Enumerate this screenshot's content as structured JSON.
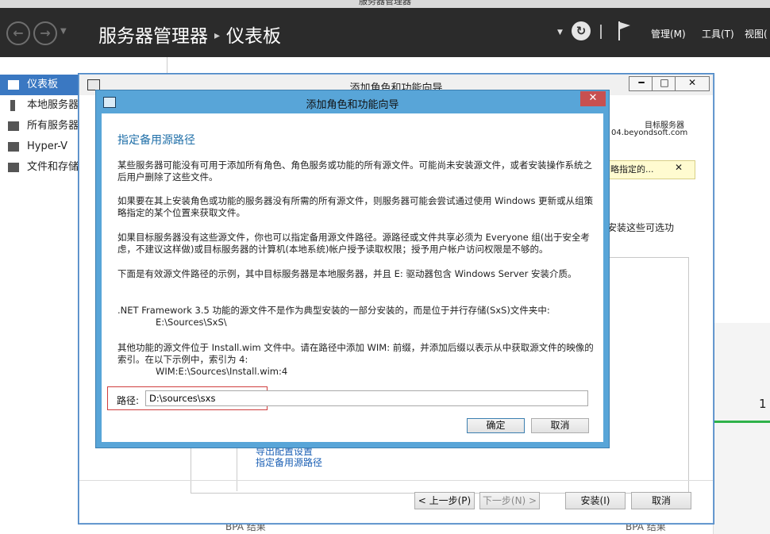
{
  "window": {
    "title": "服务器管理器"
  },
  "header": {
    "app": "服务器管理器",
    "page": "仪表板",
    "menus": [
      "管理(M)",
      "工具(T)",
      "视图("
    ]
  },
  "sidebar": {
    "items": [
      {
        "label": "仪表板",
        "icon": "dashboard-icon",
        "active": true
      },
      {
        "label": "本地服务器",
        "icon": "server-icon"
      },
      {
        "label": "所有服务器",
        "icon": "servers-icon"
      },
      {
        "label": "Hyper-V",
        "icon": "hyperv-icon"
      },
      {
        "label": "文件和存储服务",
        "icon": "storage-icon"
      }
    ]
  },
  "outer_wizard": {
    "title": "添加角色和功能向导",
    "target_label": "目标服务器",
    "target_value": "04.beyondsoft.com",
    "notice": "略指定的...",
    "side_text": "安装这些可选功",
    "links": [
      "导出配置设置",
      "指定备用源路径"
    ],
    "buttons": {
      "prev": "< 上一步(P)",
      "next": "下一步(N) >",
      "install": "安装(I)",
      "cancel": "取消"
    },
    "bpa_left": "BPA 结果",
    "bpa_right": "BPA 结果",
    "peek_number": "1"
  },
  "dialog": {
    "title": "添加角色和功能向导",
    "heading": "指定备用源路径",
    "paragraphs": [
      "某些服务器可能没有可用于添加所有角色、角色服务或功能的所有源文件。可能尚未安装源文件，或者安装操作系统之后用户删除了这些文件。",
      "如果要在其上安装角色或功能的服务器没有所需的所有源文件，则服务器可能会尝试通过使用 Windows 更新或从组策略指定的某个位置来获取文件。",
      "如果目标服务器没有这些源文件，你也可以指定备用源文件路径。源路径或文件共享必须为 Everyone 组(出于安全考虑，不建议这样做)或目标服务器的计算机(本地系统)帐户授予读取权限；授予用户帐户访问权限是不够的。",
      "下面是有效源文件路径的示例，其中目标服务器是本地服务器，并且 E: 驱动器包含 Windows Server 安装介质。",
      ".NET Framework 3.5 功能的源文件不是作为典型安装的一部分安装的，而是位于并行存储(SxS)文件夹中:",
      "其他功能的源文件位于 Install.wim 文件中。请在路径中添加 WIM: 前缀，并添加后缀以表示从中获取源文件的映像的索引。在以下示例中，索引为 4:"
    ],
    "example_sxs": "E:\\Sources\\SxS\\",
    "example_wim": "WIM:E:\\Sources\\Install.wim:4",
    "path_label": "路径:",
    "path_value": "D:\\sources\\sxs",
    "ok": "确定",
    "cancel": "取消"
  },
  "colors": {
    "accent": "#3a78c2",
    "dialog_frame": "#58a5d8",
    "heading": "#1f6fa8",
    "highlight": "#cf3e3e"
  }
}
